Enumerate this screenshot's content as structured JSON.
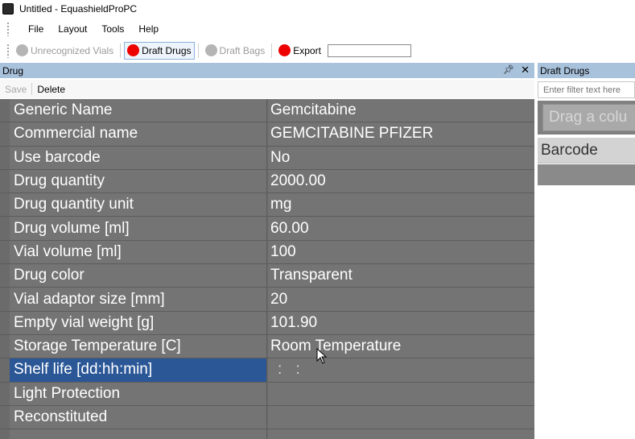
{
  "window": {
    "title": "Untitled - EquashieldProPC"
  },
  "menu": [
    "File",
    "Layout",
    "Tools",
    "Help"
  ],
  "toolbar": {
    "unrecognized_vials": "Unrecognized Vials",
    "draft_drugs": "Draft Drugs",
    "draft_bags": "Draft Bags",
    "export": "Export",
    "export_value": "",
    "status_colors": {
      "red": "#ee0000",
      "gray": "#b5b5b5"
    }
  },
  "drug_panel": {
    "title": "Drug",
    "save_label": "Save",
    "delete_label": "Delete",
    "rows": [
      {
        "name": "Generic Name",
        "value": "Gemcitabine"
      },
      {
        "name": "Commercial name",
        "value": "GEMCITABINE PFIZER"
      },
      {
        "name": "Use barcode",
        "value": "No"
      },
      {
        "name": "Drug quantity",
        "value": "2000.00"
      },
      {
        "name": "Drug quantity unit",
        "value": "mg"
      },
      {
        "name": "Drug volume [ml]",
        "value": "60.00"
      },
      {
        "name": "Vial volume [ml]",
        "value": "100"
      },
      {
        "name": "Drug color",
        "value": "Transparent"
      },
      {
        "name": "Vial adaptor size [mm]",
        "value": "20"
      },
      {
        "name": "Empty vial weight [g]",
        "value": "101.90"
      },
      {
        "name": "Storage Temperature [C]",
        "value": "Room Temperature"
      },
      {
        "name": "Shelf life [dd:hh:min]",
        "value": " : :"
      },
      {
        "name": "Light Protection",
        "value": ""
      },
      {
        "name": "Reconstituted",
        "value": ""
      },
      {
        "name": "",
        "value": ""
      }
    ],
    "selected_row": "Shelf life [dd:hh:min]"
  },
  "draft_panel": {
    "title": "Draft Drugs",
    "filter_placeholder": "Enter filter text here",
    "group_hint": "Drag a colu",
    "column": "Barcode"
  },
  "icons": {
    "pin": "pin-icon",
    "close": "close-icon"
  }
}
